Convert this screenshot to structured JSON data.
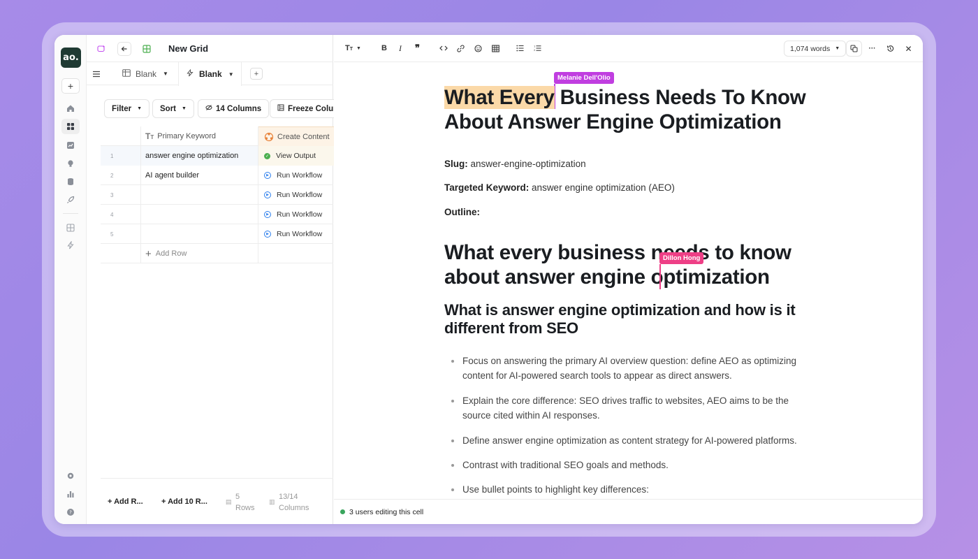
{
  "app": {
    "logo_text": "ao.",
    "title": "New Grid"
  },
  "rail": {
    "icons": [
      "plus-icon",
      "home-icon",
      "grid-apps-icon",
      "chart-icon",
      "lightbulb-icon",
      "database-icon",
      "rocket-icon",
      "table-icon",
      "bolt-icon",
      "gear-icon",
      "bar-chart-icon",
      "help-icon"
    ]
  },
  "tabs": [
    {
      "label": "Blank",
      "active": false
    },
    {
      "label": "Blank",
      "active": true
    }
  ],
  "toolbar": {
    "filter": "Filter",
    "sort": "Sort",
    "columns": "14 Columns",
    "freeze": "Freeze Columns"
  },
  "table": {
    "headers": {
      "keyword": "Primary Keyword",
      "content": "Create Content"
    },
    "rows": [
      {
        "num": "1",
        "keyword": "answer engine optimization",
        "action": "View Output",
        "status": "done"
      },
      {
        "num": "2",
        "keyword": "AI agent builder",
        "action": "Run Workflow",
        "status": "run"
      },
      {
        "num": "3",
        "keyword": "",
        "action": "Run Workflow",
        "status": "run"
      },
      {
        "num": "4",
        "keyword": "",
        "action": "Run Workflow",
        "status": "run"
      },
      {
        "num": "5",
        "keyword": "",
        "action": "Run Workflow",
        "status": "run"
      }
    ],
    "add_row": "Add Row"
  },
  "grid_footer": {
    "add_row": "Add R...",
    "add_10": "Add 10 R...",
    "rows_count": "5",
    "rows_label": "Rows",
    "cols_count": "13/14",
    "cols_label": "Columns"
  },
  "editor": {
    "word_count": "1,074 words",
    "collaborators": [
      {
        "name": "Melanie Dell'Olio",
        "color": "#c03ee0"
      },
      {
        "name": "Dillon Hong",
        "color": "#ee3f86"
      }
    ],
    "title_highlight": "What Every",
    "title_rest_1": " Business Needs To Know",
    "title_line_2": "About Answer Engine Optimization",
    "slug_label": "Slug:",
    "slug_value": "answer-engine-optimization",
    "keyword_label": "Targeted Keyword:",
    "keyword_value": "answer engine optimization (AEO)",
    "outline_label": "Outline:",
    "h1b_line1_a": "What every business n",
    "h1b_line1_b": "eeds to know",
    "h1b_line2_a": "about answer engine o",
    "h1b_line2_b": "ptimization",
    "h2_line1": "What is answer engine optimization and how is it",
    "h2_line2": "different from SEO",
    "bullets": [
      "Focus on answering the primary AI overview question: define AEO as optimizing content for AI-powered search tools to appear as direct answers.",
      "Explain the core difference: SEO drives traffic to websites, AEO aims to be the source cited within AI responses.",
      "Define answer engine optimization as content strategy for AI-powered platforms.",
      "Contrast with traditional SEO goals and methods.",
      "Use bullet points to highlight key differences:"
    ],
    "status": "3 users editing this cell"
  }
}
